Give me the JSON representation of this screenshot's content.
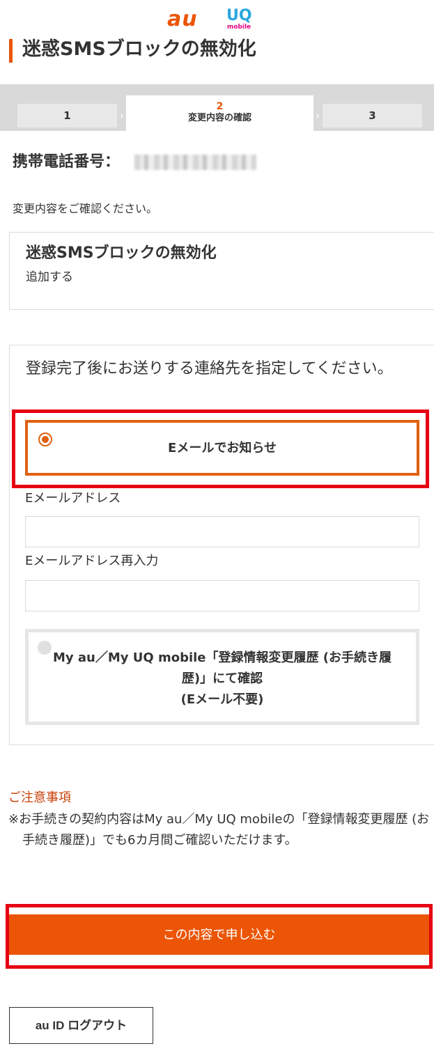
{
  "header": {
    "logo_au": "au",
    "logo_uq": "UQ",
    "logo_uq_sub": "mobile",
    "title": "迷惑SMSブロックの無効化"
  },
  "stepper": {
    "step1": "1",
    "step2_num": "2",
    "step2_label": "変更内容の確認",
    "step3": "3",
    "separator": "›"
  },
  "phone": {
    "label": "携帯電話番号："
  },
  "confirm_text": "変更内容をご確認ください。",
  "change_box": {
    "heading": "迷惑SMSブロックの無効化",
    "detail": "追加する"
  },
  "contact_box": {
    "question": "登録完了後にお送りする連絡先を指定してください。",
    "option_email": "Eメールでお知らせ",
    "email_label": "Eメールアドレス",
    "email_value": "",
    "email_confirm_label": "Eメールアドレス再入力",
    "email_confirm_value": "",
    "option_myau": "My au／My UQ mobile「登録情報変更履歴 (お手続き履歴)」にて確認\n(Eメール不要)"
  },
  "notice": {
    "heading": "ご注意事項",
    "text": "※お手続きの契約内容はMy au／My UQ mobileの「登録情報変更履歴 (お手続き履歴)」でも6カ月間ご確認いただけます。"
  },
  "buttons": {
    "submit": "この内容で申し込む",
    "logout": "au ID ログアウト"
  },
  "colors": {
    "accent": "#eb5505",
    "highlight": "#e60012"
  }
}
